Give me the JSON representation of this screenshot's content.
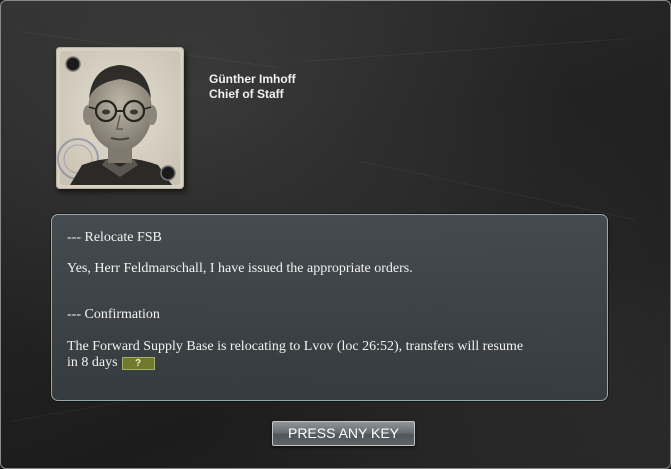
{
  "officer": {
    "name": "Günther Imhoff",
    "title": "Chief of Staff"
  },
  "message": {
    "heading_1": "--- Relocate FSB",
    "body_1": "Yes, Herr Feldmarschall, I have issued the appropriate orders.",
    "heading_2": "--- Confirmation",
    "body_2_line_1": "The Forward Supply Base is relocating to Lvov (loc 26:52), transfers will resume",
    "body_2_line_2": "in 8 days",
    "help_badge": "?"
  },
  "actions": {
    "press_any_key_label": "PRESS ANY KEY"
  },
  "colors": {
    "background": "#222222",
    "panel": "#4a5257",
    "panel_border": "#9aa6ad",
    "help_badge": "#6f7a2e",
    "text": "#f2f2f2"
  }
}
